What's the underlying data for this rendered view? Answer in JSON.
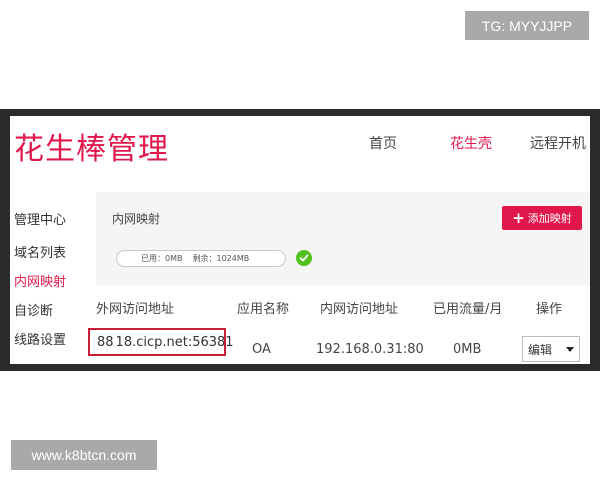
{
  "watermarks": {
    "top": "TG: MYYJJPP",
    "bottom": "www.k8btcn.com"
  },
  "header": {
    "logo": "花生棒管理",
    "nav": [
      {
        "label": "首页",
        "active": false
      },
      {
        "label": "花生壳",
        "active": true
      },
      {
        "label": "远程开机",
        "active": false
      }
    ]
  },
  "sidebar": {
    "items": [
      {
        "label": "管理中心",
        "active": false
      },
      {
        "label": "域名列表",
        "active": false
      },
      {
        "label": "内网映射",
        "active": true
      },
      {
        "label": "自诊断",
        "active": false
      },
      {
        "label": "线路设置",
        "active": false
      }
    ]
  },
  "content": {
    "section_title": "内网映射",
    "add_button": "添加映射",
    "usage": {
      "used": "已用：0MB",
      "remaining": "剩余：1024MB"
    }
  },
  "table": {
    "headers": [
      "外网访问地址",
      "应用名称",
      "内网访问地址",
      "已用流量/月",
      "操作"
    ],
    "row": {
      "external_prefix": "88",
      "external_suffix": "18.cicp.net:56381",
      "app": "OA",
      "internal": "192.168.0.31:80",
      "traffic": "0MB",
      "action": "编辑"
    }
  },
  "colors": {
    "brand": "#e0174b",
    "ok": "#52c11d",
    "highlight_border": "#c81e3a"
  }
}
